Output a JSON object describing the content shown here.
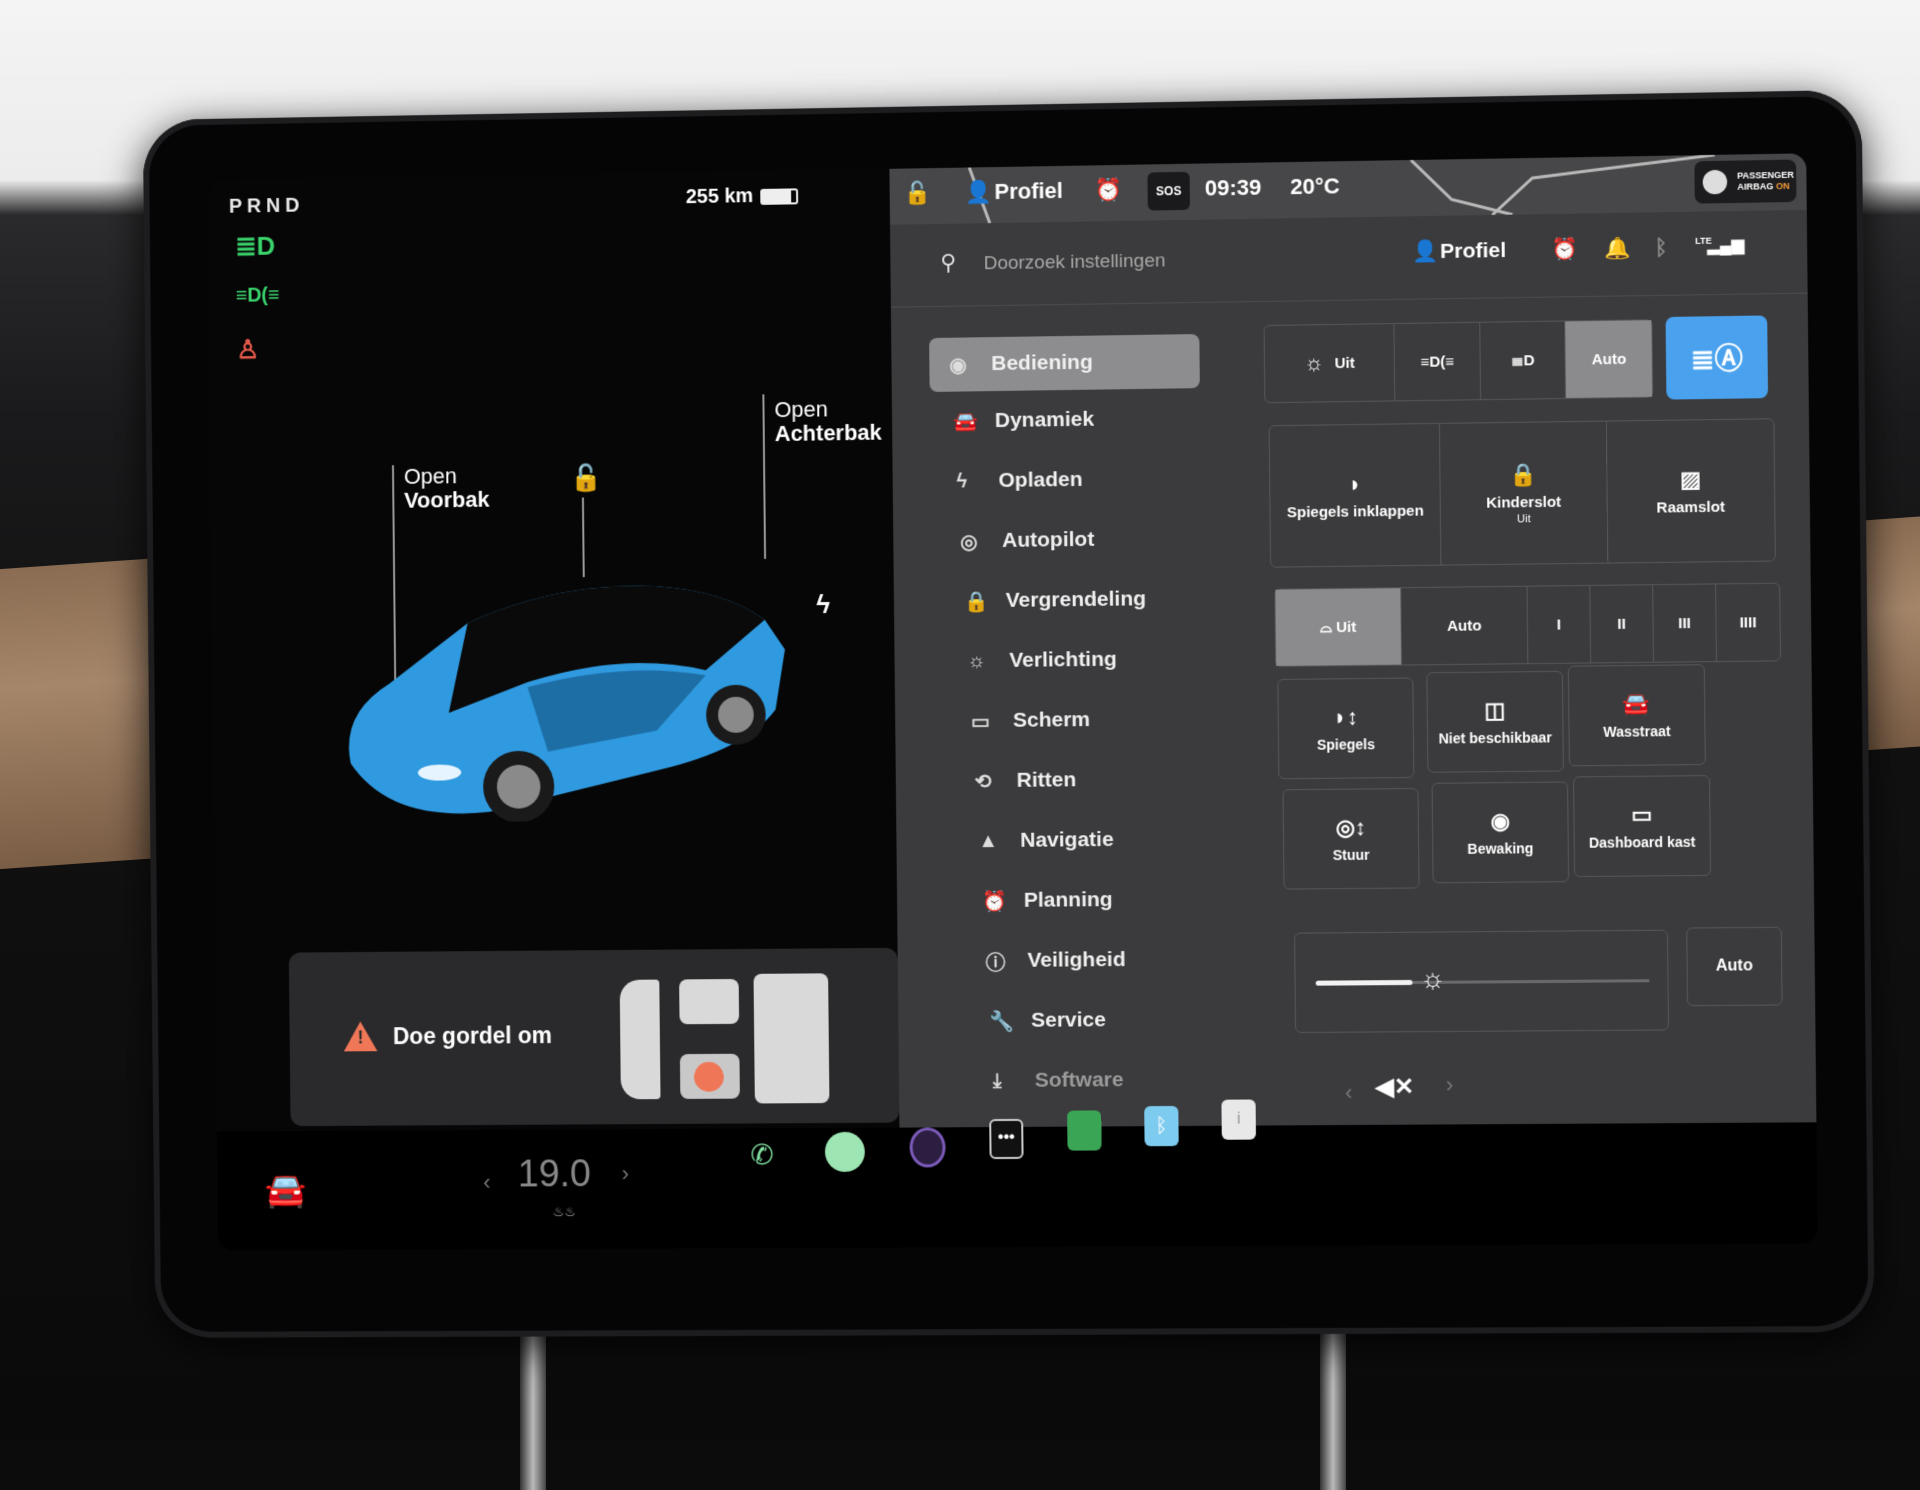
{
  "left": {
    "gear": "PRND",
    "indicators": [
      "headlight-high-icon",
      "parking-lights-icon",
      "seatbelt-warning-icon"
    ],
    "range": "255 km",
    "battery_fraction": 0.85,
    "callouts": {
      "frunk": {
        "line1": "Open",
        "line2": "Voorbak"
      },
      "trunk": {
        "line1": "Open",
        "line2": "Achterbak"
      }
    },
    "alert": {
      "message": "Doe gordel om"
    }
  },
  "status_bar": {
    "profile": "Profiel",
    "sos": "SOS",
    "time": "09:39",
    "temperature": "20°C",
    "airbag": {
      "line1": "PASSENGER",
      "line2": "AIRBAG",
      "state": "ON"
    }
  },
  "settings_header": {
    "search_placeholder": "Doorzoek instellingen",
    "profile": "Profiel",
    "lte": "LTE"
  },
  "nav": {
    "items": [
      {
        "label": "Bediening",
        "icon": "toggle",
        "active": true
      },
      {
        "label": "Dynamiek",
        "icon": "car"
      },
      {
        "label": "Opladen",
        "icon": "bolt"
      },
      {
        "label": "Autopilot",
        "icon": "steering-wheel"
      },
      {
        "label": "Vergrendeling",
        "icon": "lock"
      },
      {
        "label": "Verlichting",
        "icon": "light"
      },
      {
        "label": "Scherm",
        "icon": "display"
      },
      {
        "label": "Ritten",
        "icon": "trips"
      },
      {
        "label": "Navigatie",
        "icon": "navigation"
      },
      {
        "label": "Planning",
        "icon": "alarm"
      },
      {
        "label": "Veiligheid",
        "icon": "alert"
      },
      {
        "label": "Service",
        "icon": "wrench"
      },
      {
        "label": "Software",
        "icon": "download"
      }
    ]
  },
  "controls": {
    "lights": {
      "options": [
        "Uit",
        "",
        "",
        "Auto"
      ],
      "selected": "Auto",
      "auto_high_beam": "on"
    },
    "row2": [
      {
        "label": "Spiegels inklappen"
      },
      {
        "label": "Kinderslot",
        "sub": "Uit"
      },
      {
        "label": "Raamslot"
      }
    ],
    "wipers": {
      "options": [
        "Uit",
        "Auto",
        "I",
        "II",
        "III",
        "IIII"
      ],
      "selected": "Uit"
    },
    "tiles": [
      {
        "label": "Spiegels"
      },
      {
        "label": "Niet beschikbaar"
      },
      {
        "label": "Wasstraat"
      },
      {
        "label": "Stuur"
      },
      {
        "label": "Bewaking"
      },
      {
        "label": "Dashboard kast"
      }
    ],
    "brightness": {
      "value_fraction": 0.35,
      "auto_label": "Auto"
    }
  },
  "dock": {
    "temperature": "19.0",
    "apps": [
      "phone",
      "spotify",
      "camera",
      "more",
      "stocks",
      "bluetooth",
      "info"
    ],
    "volume": "muted"
  }
}
